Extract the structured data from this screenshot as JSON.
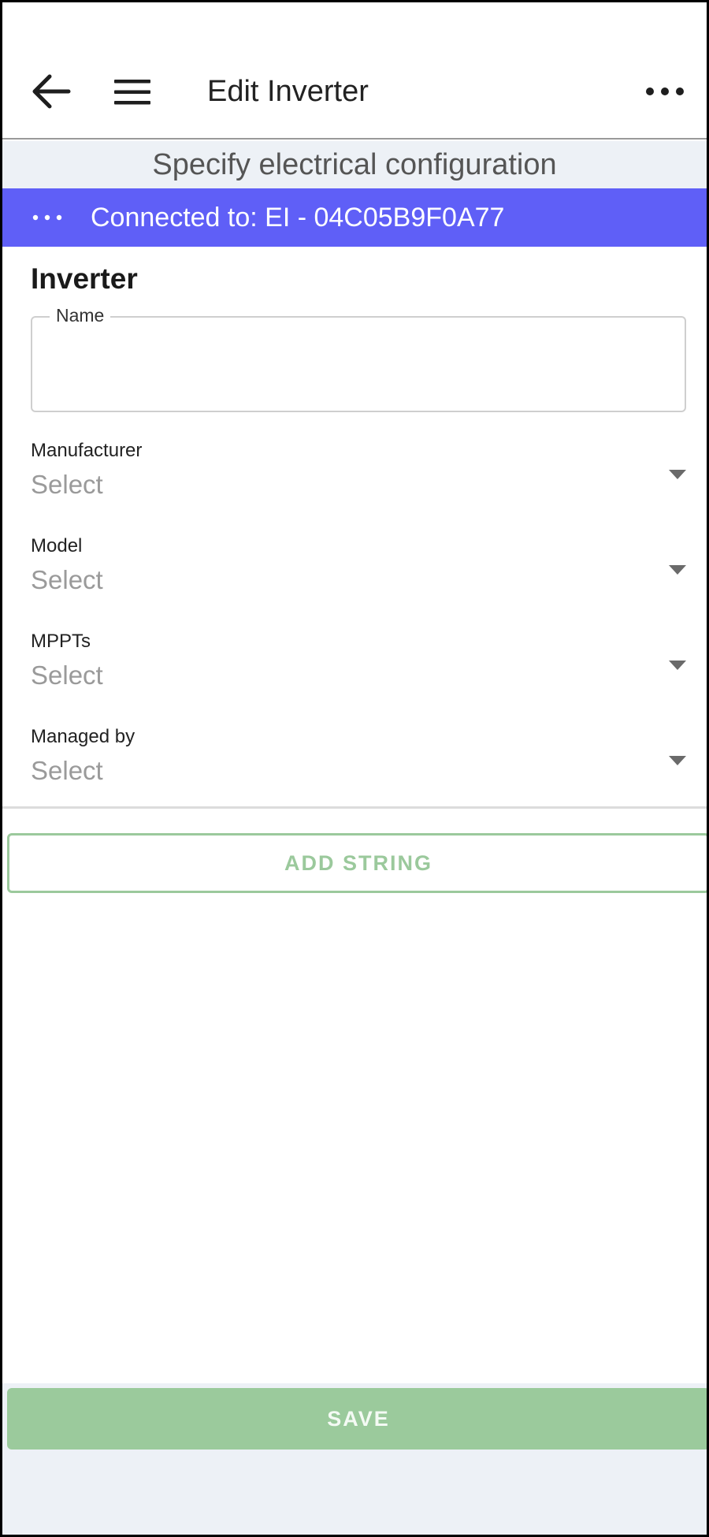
{
  "header": {
    "title": "Edit Inverter",
    "back_icon": "arrow-left-icon",
    "menu_icon": "hamburger-menu-icon",
    "more_icon": "more-horizontal-icon"
  },
  "step": {
    "text": "Specify electrical configuration"
  },
  "connection": {
    "text": "Connected to: EI - 04C05B9F0A77",
    "bar_color": "#5f5ff7"
  },
  "form": {
    "section_title": "Inverter",
    "name": {
      "label": "Name",
      "value": ""
    },
    "selects": [
      {
        "label": "Manufacturer",
        "value": "Select"
      },
      {
        "label": "Model",
        "value": "Select"
      },
      {
        "label": "MPPTs",
        "value": "Select"
      },
      {
        "label": "Managed by",
        "value": "Select"
      }
    ]
  },
  "actions": {
    "add_string": "ADD STRING",
    "save": "SAVE",
    "accent_color": "#9bca9c"
  }
}
